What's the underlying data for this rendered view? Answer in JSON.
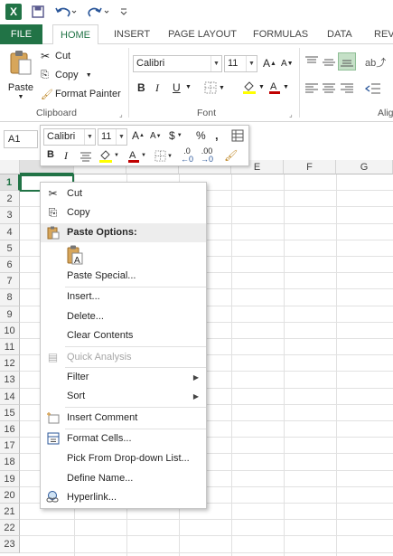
{
  "qat": {
    "logo": "X",
    "save_icon": "save-icon",
    "undo_icon": "undo-icon",
    "redo_icon": "redo-icon"
  },
  "tabs": [
    {
      "label": "FILE"
    },
    {
      "label": "HOME"
    },
    {
      "label": "INSERT"
    },
    {
      "label": "PAGE LAYOUT"
    },
    {
      "label": "FORMULAS"
    },
    {
      "label": "DATA"
    },
    {
      "label": "REVI"
    }
  ],
  "clipboard": {
    "paste": "Paste",
    "cut": "Cut",
    "copy": "Copy",
    "format_painter": "Format Painter",
    "label": "Clipboard"
  },
  "font": {
    "name": "Calibri",
    "size": "11",
    "label": "Font",
    "bold": "B",
    "italic": "I",
    "underline": "U"
  },
  "alignment": {
    "label": "Alig"
  },
  "name_box": "A1",
  "mini_toolbar": {
    "font_name": "Calibri",
    "font_size": "11",
    "grow": "A",
    "shrink": "A",
    "currency": "$",
    "percent": "%",
    "comma": ",",
    "bold": "B",
    "italic": "I",
    "inc_dec": ".0",
    "dec_dec": ".00"
  },
  "columns": [
    "E",
    "F",
    "G"
  ],
  "rows": [
    "1",
    "2",
    "3",
    "4",
    "5",
    "6",
    "7",
    "8",
    "9",
    "10",
    "11",
    "12",
    "13",
    "14",
    "15",
    "16",
    "17",
    "18",
    "19",
    "20",
    "21",
    "22",
    "23"
  ],
  "menu": {
    "cut": "Cut",
    "copy": "Copy",
    "paste_options": "Paste Options:",
    "paste_special": "Paste Special...",
    "insert": "Insert...",
    "delete": "Delete...",
    "clear_contents": "Clear Contents",
    "quick_analysis": "Quick Analysis",
    "filter": "Filter",
    "sort": "Sort",
    "insert_comment": "Insert Comment",
    "format_cells": "Format Cells...",
    "pick_list": "Pick From Drop-down List...",
    "define_name": "Define Name...",
    "hyperlink": "Hyperlink..."
  },
  "colors": {
    "accent": "#217346",
    "font_red": "#c00000",
    "highlight_yellow": "#ffff00"
  }
}
